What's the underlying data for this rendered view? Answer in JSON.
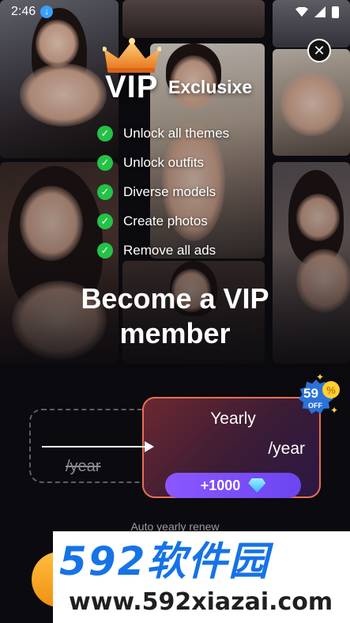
{
  "status_bar": {
    "time": "2:46"
  },
  "close": {
    "icon": "close-icon",
    "glyph": "✕"
  },
  "header": {
    "title": "VIP",
    "subtitle": "Exclusixe"
  },
  "features": [
    {
      "label": "Unlock all themes"
    },
    {
      "label": "Unlock outfits"
    },
    {
      "label": "Diverse models"
    },
    {
      "label": "Create photos"
    },
    {
      "label": "Remove all ads"
    }
  ],
  "headline": {
    "line1": "Become a VIP",
    "line2": "member"
  },
  "plans": {
    "monthly": {
      "price_strikethrough": "/year"
    },
    "yearly": {
      "name": "Yearly",
      "period": "/year",
      "bonus": "+1000",
      "selected": true
    },
    "badge": {
      "percent": "59",
      "off": "OFF",
      "coin": "%"
    }
  },
  "renew_note": "Auto yearly renew",
  "watermark": {
    "brand": "592软件园",
    "url": "www.592xiazai.com"
  },
  "colors": {
    "accent": "#e9704f",
    "check": "#24c247",
    "bonus": "#8c57ff",
    "badge": "#2b72d8",
    "cta": "#f6a623"
  }
}
